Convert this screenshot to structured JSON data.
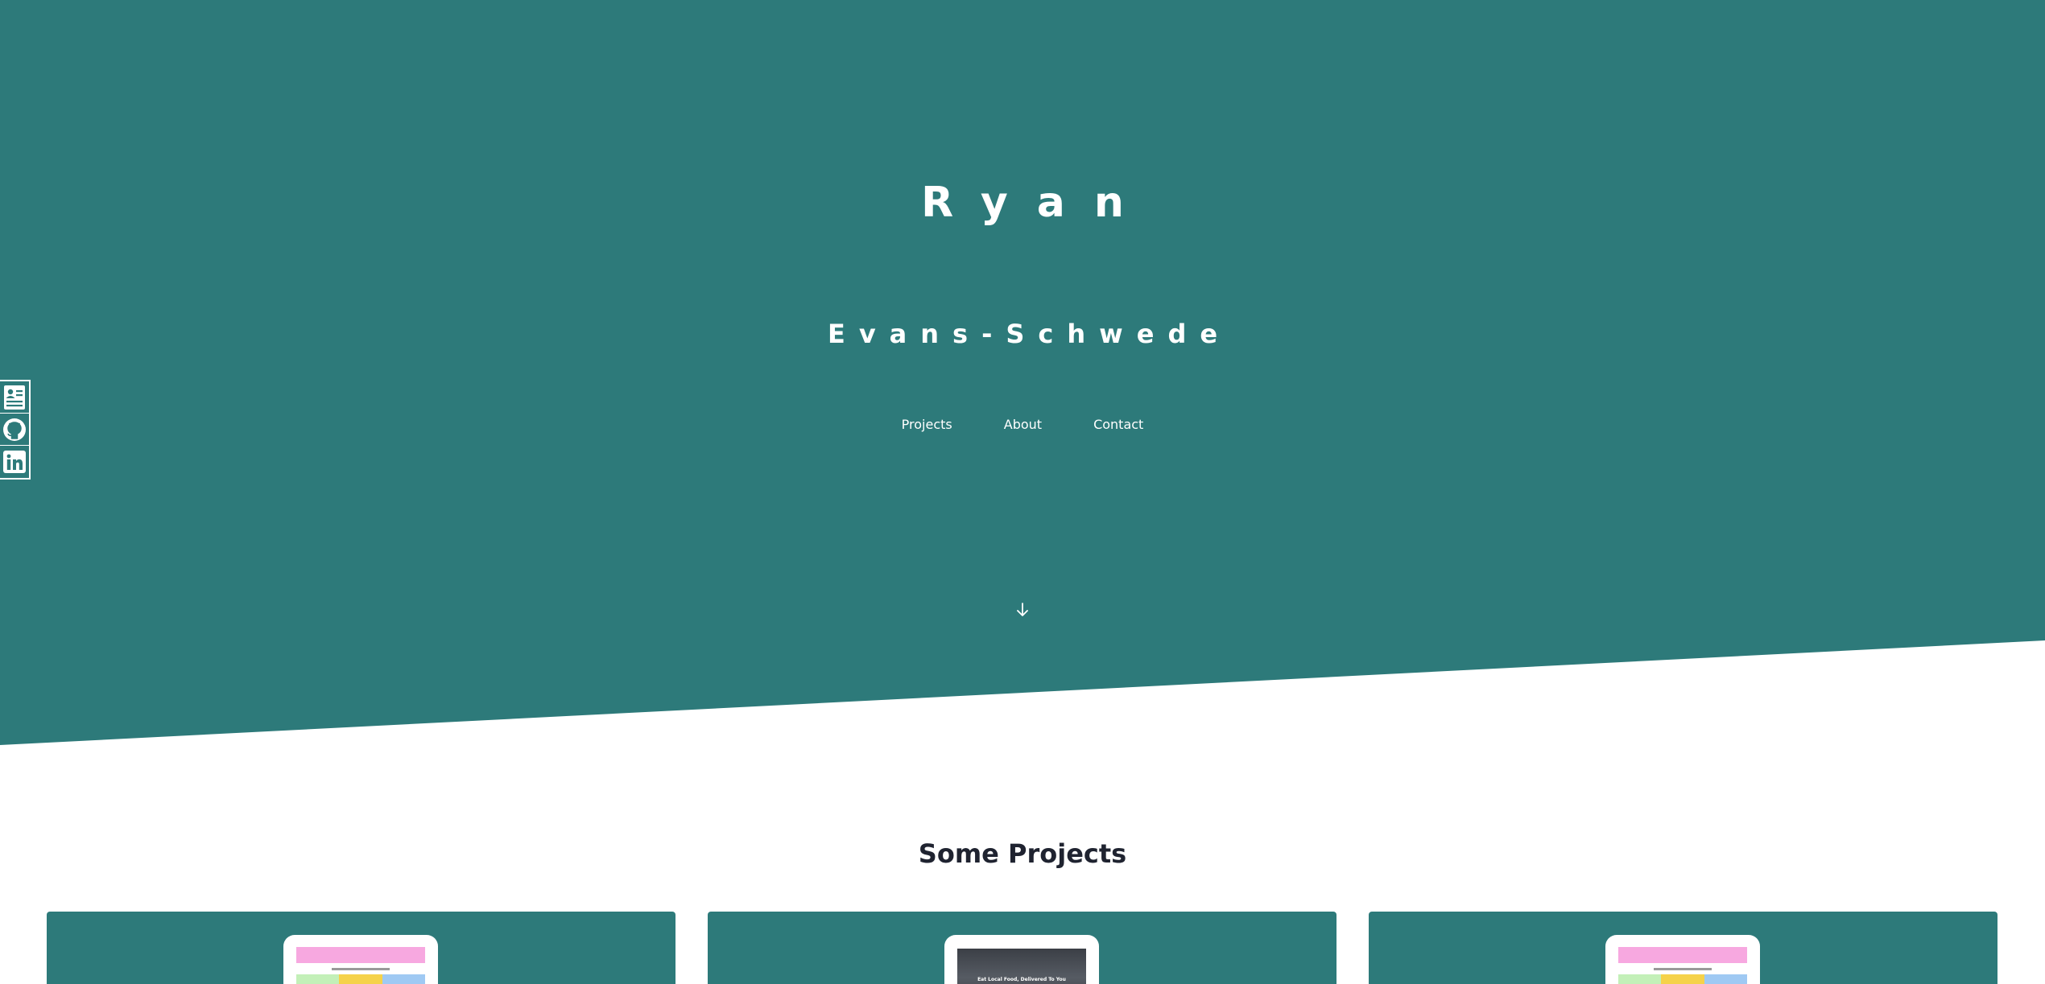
{
  "hero": {
    "first_name": "Ryan",
    "last_name": "Evans-Schwede",
    "background_color": "#2d7a7a"
  },
  "nav": {
    "items": [
      {
        "label": "Projects"
      },
      {
        "label": "About"
      },
      {
        "label": "Contact"
      }
    ]
  },
  "scroll": {
    "icon": "arrow-down-icon"
  },
  "social": {
    "items": [
      {
        "icon": "resume-icon"
      },
      {
        "icon": "github-icon"
      },
      {
        "icon": "linkedin-icon"
      }
    ]
  },
  "projects": {
    "title": "Some Projects",
    "cards": [
      {
        "thumbnail": "colorful-grid-site"
      },
      {
        "thumbnail": "photo-banner-site",
        "caption": "Eat Local Food, Delivered To You"
      },
      {
        "thumbnail": "colorful-grid-site"
      }
    ]
  }
}
